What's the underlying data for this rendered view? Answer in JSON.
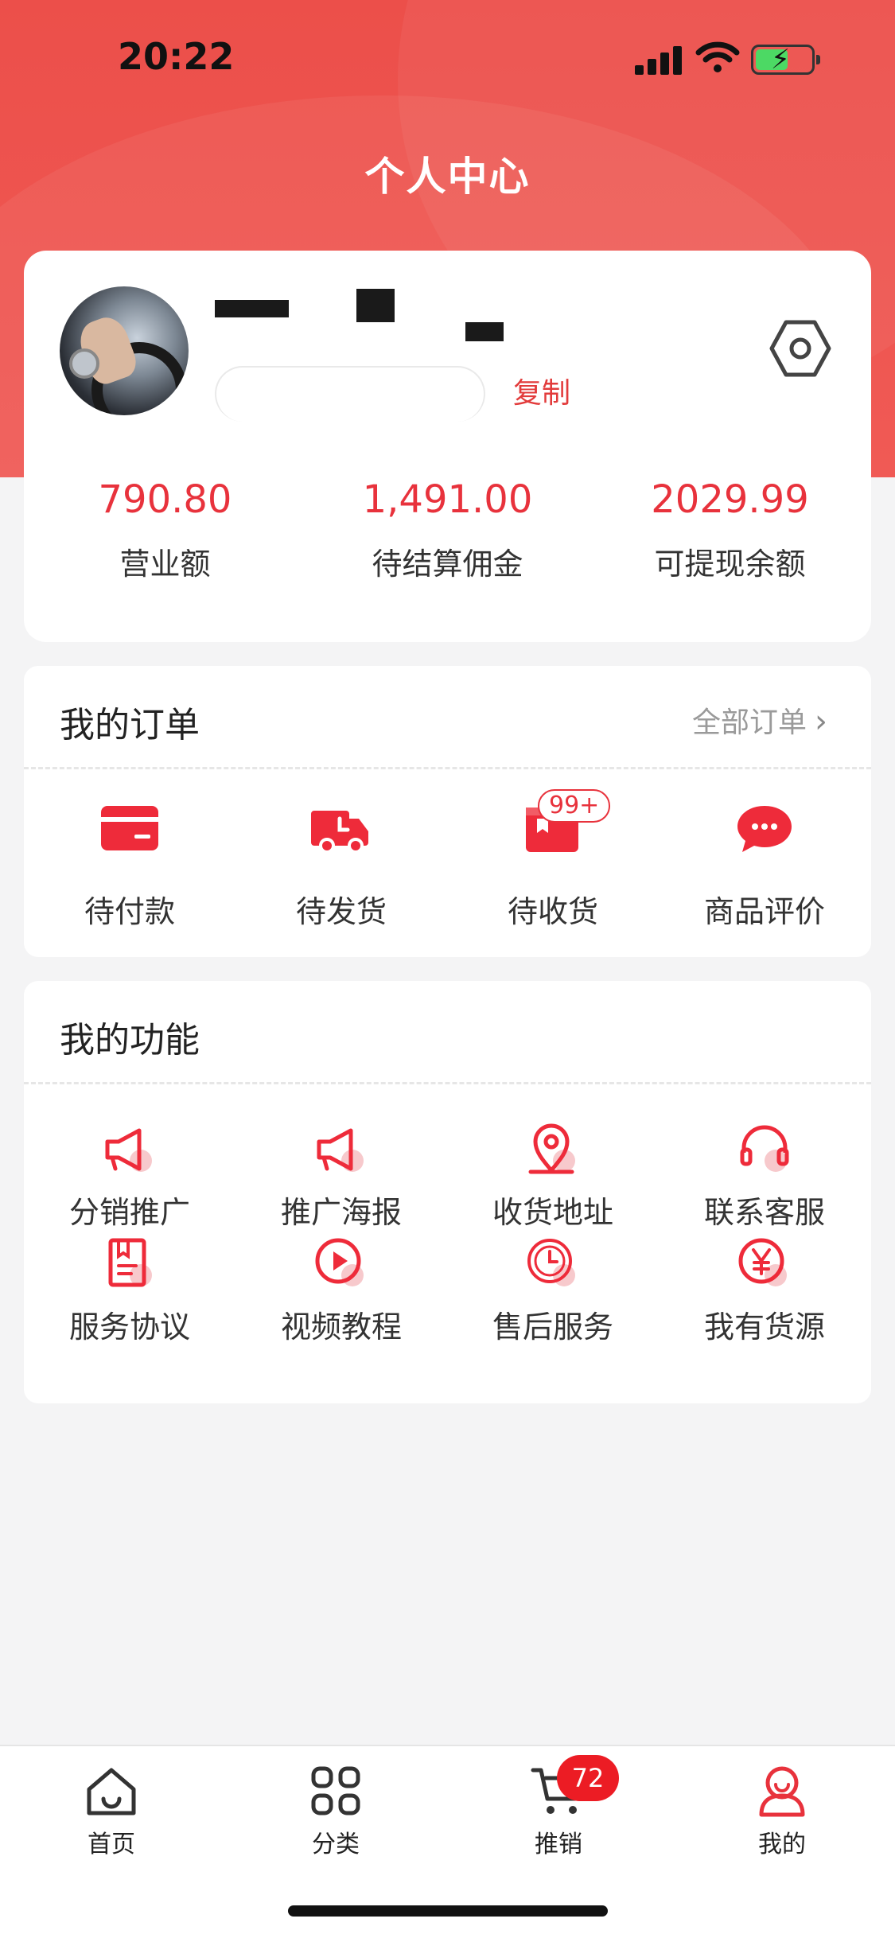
{
  "status_bar": {
    "time": "20:22"
  },
  "header": {
    "title": "个人中心"
  },
  "profile": {
    "copy_label": "复制",
    "stats": [
      {
        "value": "790.80",
        "label": "营业额"
      },
      {
        "value": "1,491.00",
        "label": "待结算佣金"
      },
      {
        "value": "2029.99",
        "label": "可提现余额"
      }
    ]
  },
  "orders": {
    "title": "我的订单",
    "all_label": "全部订单",
    "items": [
      {
        "label": "待付款",
        "icon": "card-icon"
      },
      {
        "label": "待发货",
        "icon": "truck-icon"
      },
      {
        "label": "待收货",
        "icon": "package-icon",
        "badge": "99+"
      },
      {
        "label": "商品评价",
        "icon": "chat-bubble-icon"
      }
    ]
  },
  "functions": {
    "title": "我的功能",
    "items": [
      {
        "label": "分销推广",
        "icon": "megaphone-icon"
      },
      {
        "label": "推广海报",
        "icon": "megaphone-icon"
      },
      {
        "label": "收货地址",
        "icon": "location-pin-icon"
      },
      {
        "label": "联系客服",
        "icon": "headset-icon"
      },
      {
        "label": "服务协议",
        "icon": "document-icon"
      },
      {
        "label": "视频教程",
        "icon": "play-icon"
      },
      {
        "label": "售后服务",
        "icon": "clock-icon"
      },
      {
        "label": "我有货源",
        "icon": "yen-icon"
      }
    ]
  },
  "tabbar": {
    "items": [
      {
        "label": "首页",
        "icon": "home-icon"
      },
      {
        "label": "分类",
        "icon": "grid-icon"
      },
      {
        "label": "推销",
        "icon": "cart-icon"
      },
      {
        "label": "我的",
        "icon": "user-icon"
      }
    ],
    "cart_badge": "72"
  },
  "colors": {
    "brand_red": "#e8323c",
    "header_red": "#ec4f4a"
  }
}
